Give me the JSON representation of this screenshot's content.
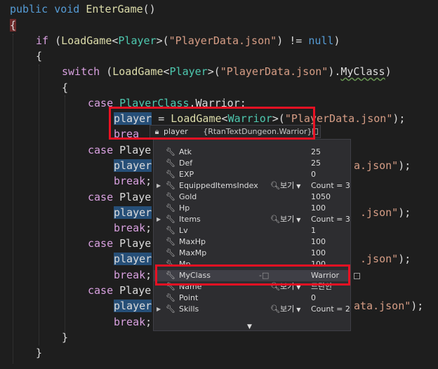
{
  "code": {
    "l1": {
      "a": "public",
      "b": "void",
      "c": "EnterGame",
      "d": "()"
    },
    "l2": "{",
    "l3": {
      "a": "if",
      "b": " (",
      "c": "LoadGame",
      "d": "<",
      "e": "Player",
      "f": ">(",
      "g": "\"PlayerData.json\"",
      "h": ") != ",
      "i": "null",
      "j": ")"
    },
    "l4": "{",
    "l5": {
      "a": "switch",
      "b": " (",
      "c": "LoadGame",
      "d": "<",
      "e": "Player",
      "f": ">(",
      "g": "\"PlayerData.json\"",
      "h": ").",
      "i": "MyClass",
      "j": ")"
    },
    "l6": "{",
    "l7": {
      "a": "case",
      "b": " ",
      "c": "PlayerClass",
      "d": ".",
      "e": "Warrior",
      "f": ":"
    },
    "l8": {
      "a": "player",
      "b": " = ",
      "c": "LoadGame",
      "d": "<",
      "e": "Warrior",
      "f": ">(",
      "g": "\"PlayerData.json\"",
      "h": ");"
    },
    "l9": {
      "a": "brea"
    },
    "l10": {
      "a": "case",
      "b": " Playe"
    },
    "l11": {
      "a": "player",
      "b": "a.json\"",
      "c": ");"
    },
    "l12": {
      "a": "break",
      "b": ";"
    },
    "l13": {
      "a": "case",
      "b": " Playe"
    },
    "l14": {
      "a": "player",
      "b": ".json\"",
      "c": ");"
    },
    "l15": {
      "a": "break",
      "b": ";"
    },
    "l16": {
      "a": "case",
      "b": " Playe"
    },
    "l17": {
      "a": "player",
      "b": ".json\"",
      "c": ");"
    },
    "l18": {
      "a": "break",
      "b": ";"
    },
    "l19": {
      "a": "case",
      "b": " Playe"
    },
    "l20": {
      "a": "player",
      "b": "ata.json\"",
      "c": ");"
    },
    "l21": {
      "a": "break",
      "b": ";"
    },
    "l22": "}",
    "l23": "}"
  },
  "tooltip": {
    "name": "player",
    "value": "{RtanTextDungeon.Warrior}",
    "icon": "lock-icon"
  },
  "members": [
    {
      "name": "Atk",
      "value": "25",
      "expandable": false,
      "viewer": ""
    },
    {
      "name": "Def",
      "value": "25",
      "expandable": false,
      "viewer": ""
    },
    {
      "name": "EXP",
      "value": "0",
      "expandable": false,
      "viewer": ""
    },
    {
      "name": "EquippedItemsIndex",
      "value": "Count = 3",
      "expandable": true,
      "viewer": "보기"
    },
    {
      "name": "Gold",
      "value": "1050",
      "expandable": false,
      "viewer": ""
    },
    {
      "name": "Hp",
      "value": "100",
      "expandable": false,
      "viewer": ""
    },
    {
      "name": "Items",
      "value": "Count = 3",
      "expandable": true,
      "viewer": "보기"
    },
    {
      "name": "Lv",
      "value": "1",
      "expandable": false,
      "viewer": ""
    },
    {
      "name": "MaxHp",
      "value": "100",
      "expandable": false,
      "viewer": ""
    },
    {
      "name": "MaxMp",
      "value": "100",
      "expandable": false,
      "viewer": ""
    },
    {
      "name": "Mp",
      "value": "100",
      "expandable": false,
      "viewer": ""
    },
    {
      "name": "MyClass",
      "value": "Warrior",
      "expandable": false,
      "viewer": ""
    },
    {
      "name": "Name",
      "value": "드란안",
      "expandable": false,
      "viewer": "보기"
    },
    {
      "name": "Point",
      "value": "0",
      "expandable": false,
      "viewer": ""
    },
    {
      "name": "Skills",
      "value": "Count = 2",
      "expandable": true,
      "viewer": "보기"
    }
  ],
  "more_arrow": "▼",
  "colors": {
    "highlight_box": "#e81123",
    "editor_bg": "#1e1e1e",
    "keyword": "#569cd6",
    "type": "#4ec9b0",
    "string": "#d69d85"
  }
}
